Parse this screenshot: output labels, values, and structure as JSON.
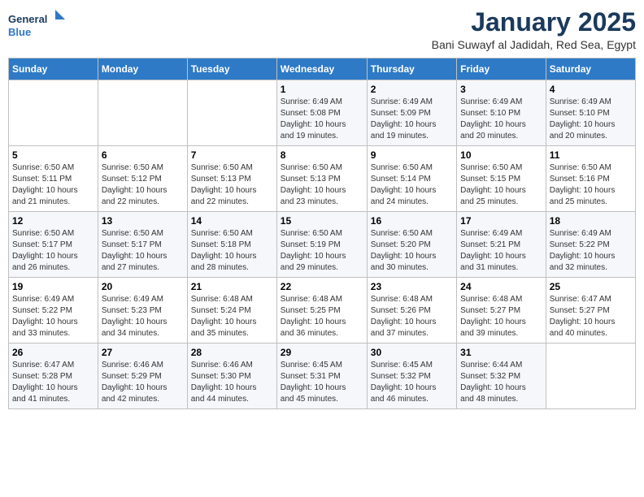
{
  "header": {
    "logo_general": "General",
    "logo_blue": "Blue",
    "month": "January 2025",
    "location": "Bani Suwayf al Jadidah, Red Sea, Egypt"
  },
  "days_of_week": [
    "Sunday",
    "Monday",
    "Tuesday",
    "Wednesday",
    "Thursday",
    "Friday",
    "Saturday"
  ],
  "weeks": [
    [
      {
        "day": "",
        "info": ""
      },
      {
        "day": "",
        "info": ""
      },
      {
        "day": "",
        "info": ""
      },
      {
        "day": "1",
        "info": "Sunrise: 6:49 AM\nSunset: 5:08 PM\nDaylight: 10 hours\nand 19 minutes."
      },
      {
        "day": "2",
        "info": "Sunrise: 6:49 AM\nSunset: 5:09 PM\nDaylight: 10 hours\nand 19 minutes."
      },
      {
        "day": "3",
        "info": "Sunrise: 6:49 AM\nSunset: 5:10 PM\nDaylight: 10 hours\nand 20 minutes."
      },
      {
        "day": "4",
        "info": "Sunrise: 6:49 AM\nSunset: 5:10 PM\nDaylight: 10 hours\nand 20 minutes."
      }
    ],
    [
      {
        "day": "5",
        "info": "Sunrise: 6:50 AM\nSunset: 5:11 PM\nDaylight: 10 hours\nand 21 minutes."
      },
      {
        "day": "6",
        "info": "Sunrise: 6:50 AM\nSunset: 5:12 PM\nDaylight: 10 hours\nand 22 minutes."
      },
      {
        "day": "7",
        "info": "Sunrise: 6:50 AM\nSunset: 5:13 PM\nDaylight: 10 hours\nand 22 minutes."
      },
      {
        "day": "8",
        "info": "Sunrise: 6:50 AM\nSunset: 5:13 PM\nDaylight: 10 hours\nand 23 minutes."
      },
      {
        "day": "9",
        "info": "Sunrise: 6:50 AM\nSunset: 5:14 PM\nDaylight: 10 hours\nand 24 minutes."
      },
      {
        "day": "10",
        "info": "Sunrise: 6:50 AM\nSunset: 5:15 PM\nDaylight: 10 hours\nand 25 minutes."
      },
      {
        "day": "11",
        "info": "Sunrise: 6:50 AM\nSunset: 5:16 PM\nDaylight: 10 hours\nand 25 minutes."
      }
    ],
    [
      {
        "day": "12",
        "info": "Sunrise: 6:50 AM\nSunset: 5:17 PM\nDaylight: 10 hours\nand 26 minutes."
      },
      {
        "day": "13",
        "info": "Sunrise: 6:50 AM\nSunset: 5:17 PM\nDaylight: 10 hours\nand 27 minutes."
      },
      {
        "day": "14",
        "info": "Sunrise: 6:50 AM\nSunset: 5:18 PM\nDaylight: 10 hours\nand 28 minutes."
      },
      {
        "day": "15",
        "info": "Sunrise: 6:50 AM\nSunset: 5:19 PM\nDaylight: 10 hours\nand 29 minutes."
      },
      {
        "day": "16",
        "info": "Sunrise: 6:50 AM\nSunset: 5:20 PM\nDaylight: 10 hours\nand 30 minutes."
      },
      {
        "day": "17",
        "info": "Sunrise: 6:49 AM\nSunset: 5:21 PM\nDaylight: 10 hours\nand 31 minutes."
      },
      {
        "day": "18",
        "info": "Sunrise: 6:49 AM\nSunset: 5:22 PM\nDaylight: 10 hours\nand 32 minutes."
      }
    ],
    [
      {
        "day": "19",
        "info": "Sunrise: 6:49 AM\nSunset: 5:22 PM\nDaylight: 10 hours\nand 33 minutes."
      },
      {
        "day": "20",
        "info": "Sunrise: 6:49 AM\nSunset: 5:23 PM\nDaylight: 10 hours\nand 34 minutes."
      },
      {
        "day": "21",
        "info": "Sunrise: 6:48 AM\nSunset: 5:24 PM\nDaylight: 10 hours\nand 35 minutes."
      },
      {
        "day": "22",
        "info": "Sunrise: 6:48 AM\nSunset: 5:25 PM\nDaylight: 10 hours\nand 36 minutes."
      },
      {
        "day": "23",
        "info": "Sunrise: 6:48 AM\nSunset: 5:26 PM\nDaylight: 10 hours\nand 37 minutes."
      },
      {
        "day": "24",
        "info": "Sunrise: 6:48 AM\nSunset: 5:27 PM\nDaylight: 10 hours\nand 39 minutes."
      },
      {
        "day": "25",
        "info": "Sunrise: 6:47 AM\nSunset: 5:27 PM\nDaylight: 10 hours\nand 40 minutes."
      }
    ],
    [
      {
        "day": "26",
        "info": "Sunrise: 6:47 AM\nSunset: 5:28 PM\nDaylight: 10 hours\nand 41 minutes."
      },
      {
        "day": "27",
        "info": "Sunrise: 6:46 AM\nSunset: 5:29 PM\nDaylight: 10 hours\nand 42 minutes."
      },
      {
        "day": "28",
        "info": "Sunrise: 6:46 AM\nSunset: 5:30 PM\nDaylight: 10 hours\nand 44 minutes."
      },
      {
        "day": "29",
        "info": "Sunrise: 6:45 AM\nSunset: 5:31 PM\nDaylight: 10 hours\nand 45 minutes."
      },
      {
        "day": "30",
        "info": "Sunrise: 6:45 AM\nSunset: 5:32 PM\nDaylight: 10 hours\nand 46 minutes."
      },
      {
        "day": "31",
        "info": "Sunrise: 6:44 AM\nSunset: 5:32 PM\nDaylight: 10 hours\nand 48 minutes."
      },
      {
        "day": "",
        "info": ""
      }
    ]
  ]
}
